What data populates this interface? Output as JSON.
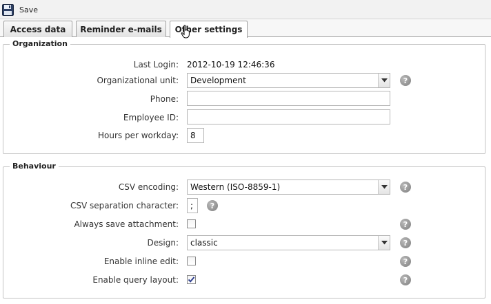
{
  "toolbar": {
    "save_label": "Save"
  },
  "tabs": [
    {
      "label": "Access data"
    },
    {
      "label": "Reminder e-mails"
    },
    {
      "label": "Other settings"
    }
  ],
  "organization": {
    "legend": "Organization",
    "last_login_label": "Last Login:",
    "last_login_value": "2012-10-19 12:46:36",
    "org_unit_label": "Organizational unit:",
    "org_unit_value": "Development",
    "phone_label": "Phone:",
    "phone_value": "",
    "employee_id_label": "Employee ID:",
    "employee_id_value": "",
    "hours_label": "Hours per workday:",
    "hours_value": "8"
  },
  "behaviour": {
    "legend": "Behaviour",
    "csv_encoding_label": "CSV encoding:",
    "csv_encoding_value": "Western (ISO-8859-1)",
    "csv_sep_label": "CSV separation character:",
    "csv_sep_value": ";",
    "always_save_label": "Always save attachment:",
    "always_save_checked": false,
    "design_label": "Design:",
    "design_value": "classic",
    "inline_edit_label": "Enable inline edit:",
    "inline_edit_checked": false,
    "query_layout_label": "Enable query layout:",
    "query_layout_checked": true
  },
  "icons": {
    "save": "floppy-disk-icon",
    "help": "question-mark-icon",
    "dropdown": "chevron-down-icon",
    "cursor": "hand-pointer-icon"
  },
  "colors": {
    "help_icon": "#8c8c8c",
    "checkbox_check": "#2f3f8f"
  }
}
